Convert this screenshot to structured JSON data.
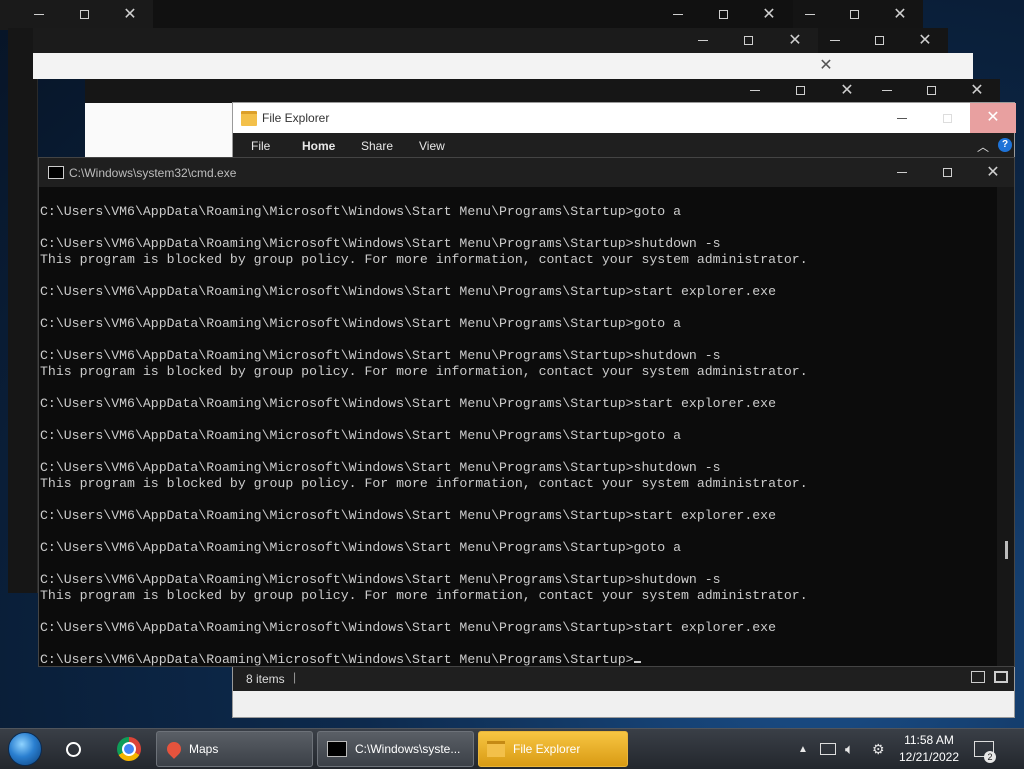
{
  "explorer": {
    "title": "File Explorer",
    "ribbon_tabs": [
      "File",
      "Home",
      "Share",
      "View"
    ],
    "status_items": "8 items",
    "help_glyph": "?"
  },
  "cmd": {
    "title": "C:\\Windows\\system32\\cmd.exe",
    "lines": [
      "C:\\Users\\VM6\\AppData\\Roaming\\Microsoft\\Windows\\Start Menu\\Programs\\Startup>goto a",
      "",
      "C:\\Users\\VM6\\AppData\\Roaming\\Microsoft\\Windows\\Start Menu\\Programs\\Startup>shutdown -s",
      "This program is blocked by group policy. For more information, contact your system administrator.",
      "",
      "C:\\Users\\VM6\\AppData\\Roaming\\Microsoft\\Windows\\Start Menu\\Programs\\Startup>start explorer.exe",
      "",
      "C:\\Users\\VM6\\AppData\\Roaming\\Microsoft\\Windows\\Start Menu\\Programs\\Startup>goto a",
      "",
      "C:\\Users\\VM6\\AppData\\Roaming\\Microsoft\\Windows\\Start Menu\\Programs\\Startup>shutdown -s",
      "This program is blocked by group policy. For more information, contact your system administrator.",
      "",
      "C:\\Users\\VM6\\AppData\\Roaming\\Microsoft\\Windows\\Start Menu\\Programs\\Startup>start explorer.exe",
      "",
      "C:\\Users\\VM6\\AppData\\Roaming\\Microsoft\\Windows\\Start Menu\\Programs\\Startup>goto a",
      "",
      "C:\\Users\\VM6\\AppData\\Roaming\\Microsoft\\Windows\\Start Menu\\Programs\\Startup>shutdown -s",
      "This program is blocked by group policy. For more information, contact your system administrator.",
      "",
      "C:\\Users\\VM6\\AppData\\Roaming\\Microsoft\\Windows\\Start Menu\\Programs\\Startup>start explorer.exe",
      "",
      "C:\\Users\\VM6\\AppData\\Roaming\\Microsoft\\Windows\\Start Menu\\Programs\\Startup>goto a",
      "",
      "C:\\Users\\VM6\\AppData\\Roaming\\Microsoft\\Windows\\Start Menu\\Programs\\Startup>shutdown -s",
      "This program is blocked by group policy. For more information, contact your system administrator.",
      "",
      "C:\\Users\\VM6\\AppData\\Roaming\\Microsoft\\Windows\\Start Menu\\Programs\\Startup>start explorer.exe",
      "",
      "C:\\Users\\VM6\\AppData\\Roaming\\Microsoft\\Windows\\Start Menu\\Programs\\Startup>"
    ]
  },
  "taskbar": {
    "apps": [
      {
        "label": "Maps",
        "icon": "maps-pin-icon"
      },
      {
        "label": "C:\\Windows\\syste...",
        "icon": "cmd-icon"
      },
      {
        "label": "File Explorer",
        "icon": "folder-icon"
      }
    ],
    "clock_time": "11:58 AM",
    "clock_date": "12/21/2022",
    "notification_count": "2"
  },
  "colors": {
    "cmd_text": "#cccccc",
    "cmd_bg": "#0c0c0c",
    "active_task": "#f0b429"
  }
}
